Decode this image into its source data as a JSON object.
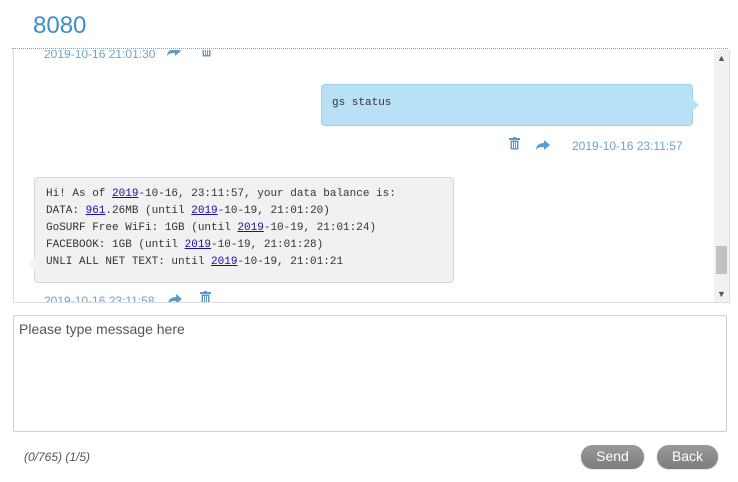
{
  "header": {
    "title": "8080"
  },
  "chat": {
    "top_partial_timestamp": "2019-10-16 21:01:30",
    "outgoing": {
      "text": "gs status",
      "timestamp": "2019-10-16 23:11:57"
    },
    "incoming": {
      "lines": [
        [
          {
            "t": "Hi! As of "
          },
          {
            "t": "2019",
            "link": true
          },
          {
            "t": "-10-16, 23:11:57, your data balance is:"
          }
        ],
        [
          {
            "t": "DATA: "
          },
          {
            "t": "961",
            "link": true
          },
          {
            "t": ".26MB (until "
          },
          {
            "t": "2019",
            "link": true
          },
          {
            "t": "-10-19, 21:01:20)"
          }
        ],
        [
          {
            "t": "GoSURF Free WiFi: 1GB (until "
          },
          {
            "t": "2019",
            "link": true
          },
          {
            "t": "-10-19, 21:01:24)"
          }
        ],
        [
          {
            "t": "FACEBOOK: 1GB (until "
          },
          {
            "t": "2019",
            "link": true
          },
          {
            "t": "-10-19, 21:01:28)"
          }
        ],
        [
          {
            "t": "UNLI ALL NET TEXT: until "
          },
          {
            "t": "2019",
            "link": true
          },
          {
            "t": "-10-19, 21:01:21"
          }
        ]
      ],
      "timestamp": "2019-10-16 23:11:58"
    }
  },
  "composer": {
    "placeholder": "Please type message here",
    "counter": "(0/765) (1/5)",
    "send_label": "Send",
    "back_label": "Back"
  }
}
